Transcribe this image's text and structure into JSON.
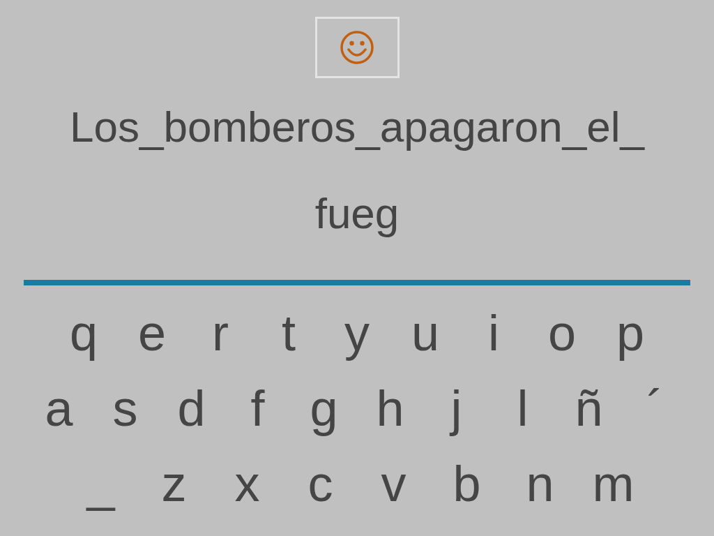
{
  "sentence_lines": [
    "Los_bomberos_apagaron_el_",
    "fueg"
  ],
  "keyboard_rows": [
    [
      "q",
      "e",
      "r",
      "t",
      "y",
      "u",
      "i",
      "o",
      "p"
    ],
    [
      "a",
      "s",
      "d",
      "f",
      "g",
      "h",
      "j",
      "l",
      "ñ",
      "´"
    ],
    [
      "_",
      "z",
      "x",
      "c",
      "v",
      "b",
      "n",
      "m"
    ]
  ]
}
